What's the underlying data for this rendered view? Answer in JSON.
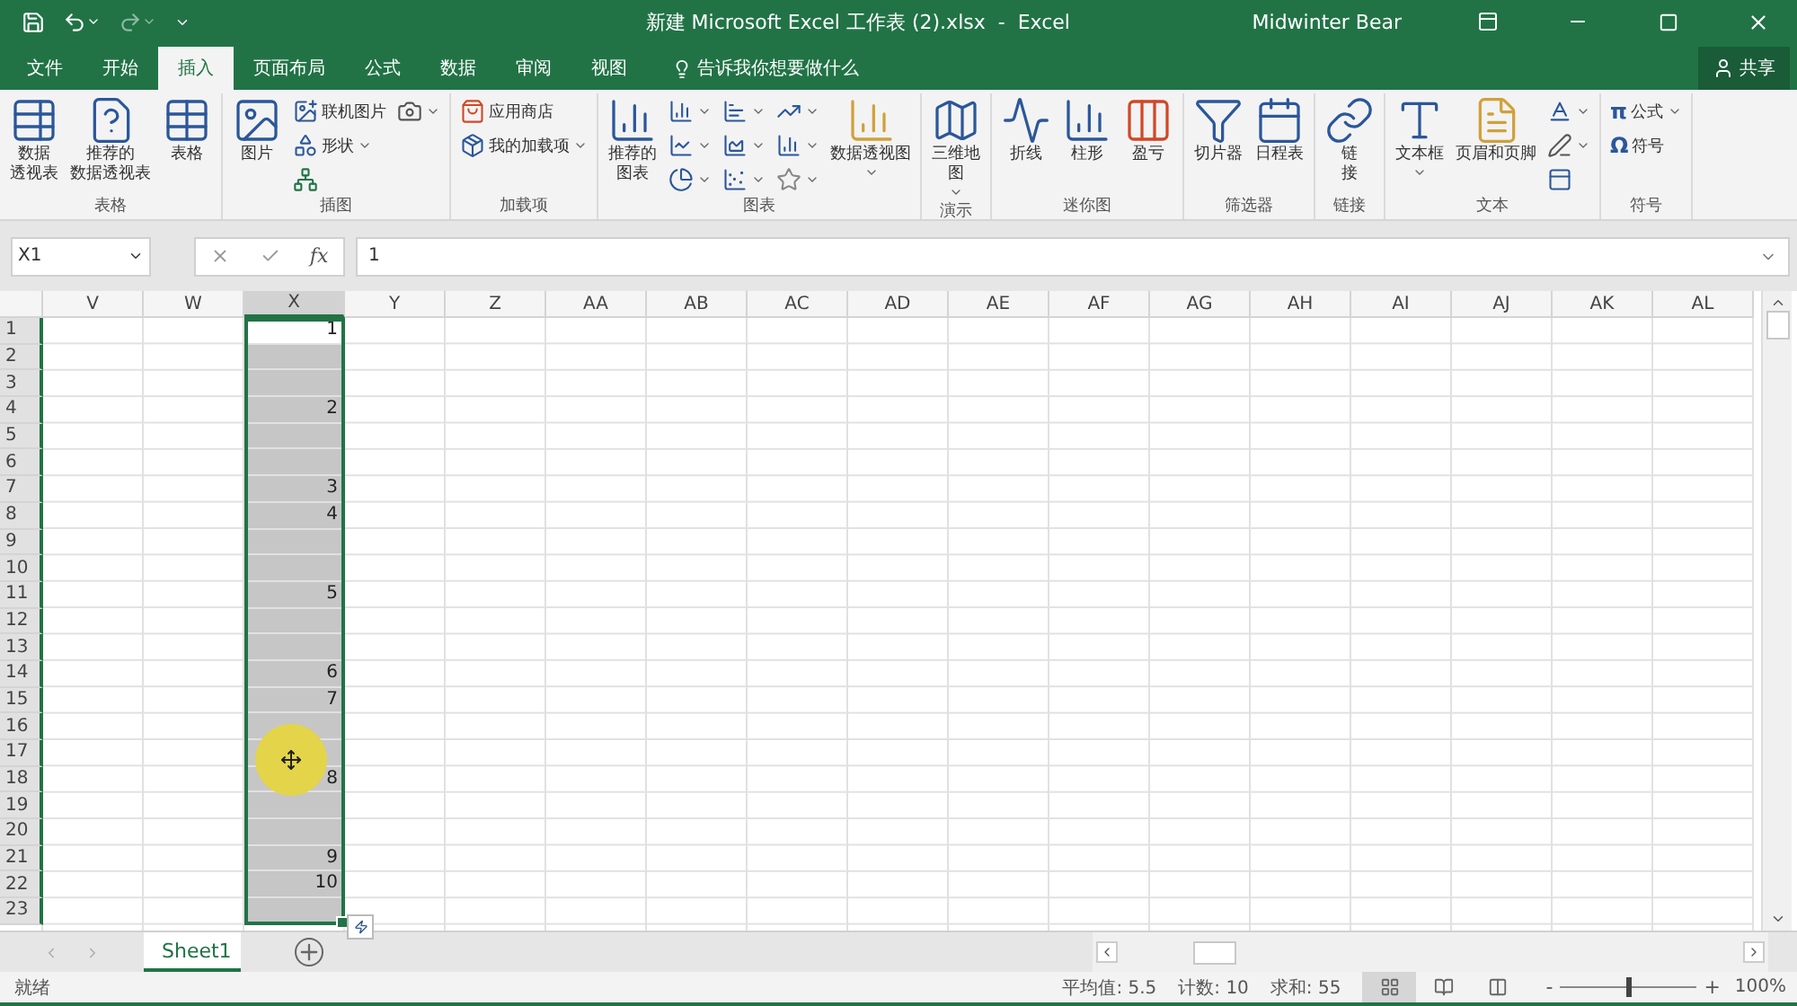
{
  "window": {
    "title": "新建 Microsoft Excel 工作表 (2).xlsx  -  Excel",
    "user": "Midwinter Bear"
  },
  "tabs": [
    {
      "label": "文件",
      "selected": false
    },
    {
      "label": "开始",
      "selected": false
    },
    {
      "label": "插入",
      "selected": true
    },
    {
      "label": "页面布局",
      "selected": false
    },
    {
      "label": "公式",
      "selected": false
    },
    {
      "label": "数据",
      "selected": false
    },
    {
      "label": "审阅",
      "selected": false
    },
    {
      "label": "视图",
      "selected": false
    }
  ],
  "tell_me": {
    "placeholder": "告诉我你想要做什么"
  },
  "share": {
    "label": "共享"
  },
  "ribbon": {
    "groups": [
      {
        "name": "表格",
        "items": [
          {
            "kind": "large",
            "lines": [
              "数据",
              "透视表"
            ],
            "dropdown": false
          },
          {
            "kind": "large",
            "lines": [
              "推荐的",
              "数据透视表"
            ],
            "dropdown": false
          },
          {
            "kind": "large",
            "lines": [
              "表格"
            ],
            "dropdown": false
          }
        ]
      },
      {
        "name": "插图",
        "items": [
          {
            "kind": "large",
            "lines": [
              "图片"
            ],
            "dropdown": false
          },
          {
            "kind": "small",
            "label": "联机图片",
            "dropdown": false
          },
          {
            "kind": "small",
            "label": "形状",
            "dropdown": true
          },
          {
            "kind": "icon",
            "dropdown": false
          },
          {
            "kind": "icon",
            "dropdown": true
          }
        ]
      },
      {
        "name": "加载项",
        "items": [
          {
            "kind": "small",
            "label": "应用商店",
            "dropdown": false
          },
          {
            "kind": "small",
            "label": "我的加载项",
            "dropdown": true
          }
        ]
      },
      {
        "name": "图表",
        "items": [
          {
            "kind": "large",
            "lines": [
              "推荐的",
              "图表"
            ],
            "dropdown": false
          },
          {
            "kind": "icon",
            "dropdown": true
          },
          {
            "kind": "icon",
            "dropdown": true
          },
          {
            "kind": "icon",
            "dropdown": true
          },
          {
            "kind": "icon",
            "dropdown": true
          },
          {
            "kind": "icon",
            "dropdown": true
          },
          {
            "kind": "icon",
            "dropdown": true
          },
          {
            "kind": "icon",
            "dropdown": true
          },
          {
            "kind": "icon",
            "dropdown": true
          },
          {
            "kind": "icon",
            "dropdown": true
          },
          {
            "kind": "large",
            "lines": [
              "数据透视图"
            ],
            "dropdown": true
          }
        ]
      },
      {
        "name": "演示",
        "items": [
          {
            "kind": "large",
            "lines": [
              "三维地",
              "图"
            ],
            "dropdown": true
          }
        ]
      },
      {
        "name": "迷你图",
        "items": [
          {
            "kind": "large",
            "lines": [
              "折线"
            ],
            "dropdown": false
          },
          {
            "kind": "large",
            "lines": [
              "柱形"
            ],
            "dropdown": false
          },
          {
            "kind": "large",
            "lines": [
              "盈亏"
            ],
            "dropdown": false
          }
        ]
      },
      {
        "name": "筛选器",
        "items": [
          {
            "kind": "large",
            "lines": [
              "切片器"
            ],
            "dropdown": false
          },
          {
            "kind": "large",
            "lines": [
              "日程表"
            ],
            "dropdown": false
          }
        ]
      },
      {
        "name": "链接",
        "items": [
          {
            "kind": "large",
            "lines": [
              "链",
              "接"
            ],
            "dropdown": false
          }
        ]
      },
      {
        "name": "文本",
        "items": [
          {
            "kind": "large",
            "lines": [
              "文本框"
            ],
            "dropdown": true
          },
          {
            "kind": "large",
            "lines": [
              "页眉和页脚"
            ],
            "dropdown": false
          },
          {
            "kind": "icon",
            "dropdown": true
          },
          {
            "kind": "icon",
            "dropdown": true
          },
          {
            "kind": "icon",
            "dropdown": false
          }
        ]
      },
      {
        "name": "符号",
        "items": [
          {
            "kind": "small",
            "glyph": "π",
            "label": "公式",
            "dropdown": true
          },
          {
            "kind": "small",
            "glyph": "Ω",
            "label": "符号",
            "dropdown": false
          }
        ]
      }
    ]
  },
  "formula_bar": {
    "name_box": "X1",
    "function_label": "fx",
    "value": "1"
  },
  "columns": [
    {
      "label": "V",
      "selected": false
    },
    {
      "label": "W",
      "selected": false
    },
    {
      "label": "X",
      "selected": true
    },
    {
      "label": "Y",
      "selected": false
    },
    {
      "label": "Z",
      "selected": false
    },
    {
      "label": "AA",
      "selected": false
    },
    {
      "label": "AB",
      "selected": false
    },
    {
      "label": "AC",
      "selected": false
    },
    {
      "label": "AD",
      "selected": false
    },
    {
      "label": "AE",
      "selected": false
    },
    {
      "label": "AF",
      "selected": false
    },
    {
      "label": "AG",
      "selected": false
    },
    {
      "label": "AH",
      "selected": false
    },
    {
      "label": "AI",
      "selected": false
    },
    {
      "label": "AJ",
      "selected": false
    },
    {
      "label": "AK",
      "selected": false
    },
    {
      "label": "AL",
      "selected": false
    }
  ],
  "rows": [
    {
      "header": "1",
      "selected": true,
      "active": true,
      "value": "1"
    },
    {
      "header": "2",
      "selected": true,
      "active": false
    },
    {
      "header": "3",
      "selected": true,
      "active": false
    },
    {
      "header": "4",
      "selected": true,
      "active": false,
      "value": "2"
    },
    {
      "header": "5",
      "selected": true,
      "active": false
    },
    {
      "header": "6",
      "selected": true,
      "active": false
    },
    {
      "header": "7",
      "selected": true,
      "active": false,
      "value": "3"
    },
    {
      "header": "8",
      "selected": true,
      "active": false,
      "value": "4"
    },
    {
      "header": "9",
      "selected": true,
      "active": false
    },
    {
      "header": "10",
      "selected": true,
      "active": false
    },
    {
      "header": "11",
      "selected": true,
      "active": false,
      "value": "5"
    },
    {
      "header": "12",
      "selected": true,
      "active": false
    },
    {
      "header": "13",
      "selected": true,
      "active": false
    },
    {
      "header": "14",
      "selected": true,
      "active": false,
      "value": "6"
    },
    {
      "header": "15",
      "selected": true,
      "active": false,
      "value": "7"
    },
    {
      "header": "16",
      "selected": true,
      "active": false
    },
    {
      "header": "17",
      "selected": true,
      "active": false
    },
    {
      "header": "18",
      "selected": true,
      "active": false,
      "value": "8"
    },
    {
      "header": "19",
      "selected": true,
      "active": false
    },
    {
      "header": "20",
      "selected": true,
      "active": false
    },
    {
      "header": "21",
      "selected": true,
      "active": false,
      "value": "9"
    },
    {
      "header": "22",
      "selected": true,
      "active": false,
      "value": "10"
    },
    {
      "header": "23",
      "selected": true,
      "active": false
    }
  ],
  "sheets": [
    {
      "label": "Sheet1",
      "selected": true
    }
  ],
  "status_bar": {
    "mode": "就绪",
    "stats": [
      "平均值: 5.5",
      "计数: 10",
      "求和: 55"
    ],
    "views": [
      {
        "selected": true
      },
      {
        "selected": false
      },
      {
        "selected": false
      }
    ],
    "zoom_out": "-",
    "zoom_in": "+",
    "zoom": {
      "level": 0.5
    },
    "zoom_label": "100%"
  }
}
